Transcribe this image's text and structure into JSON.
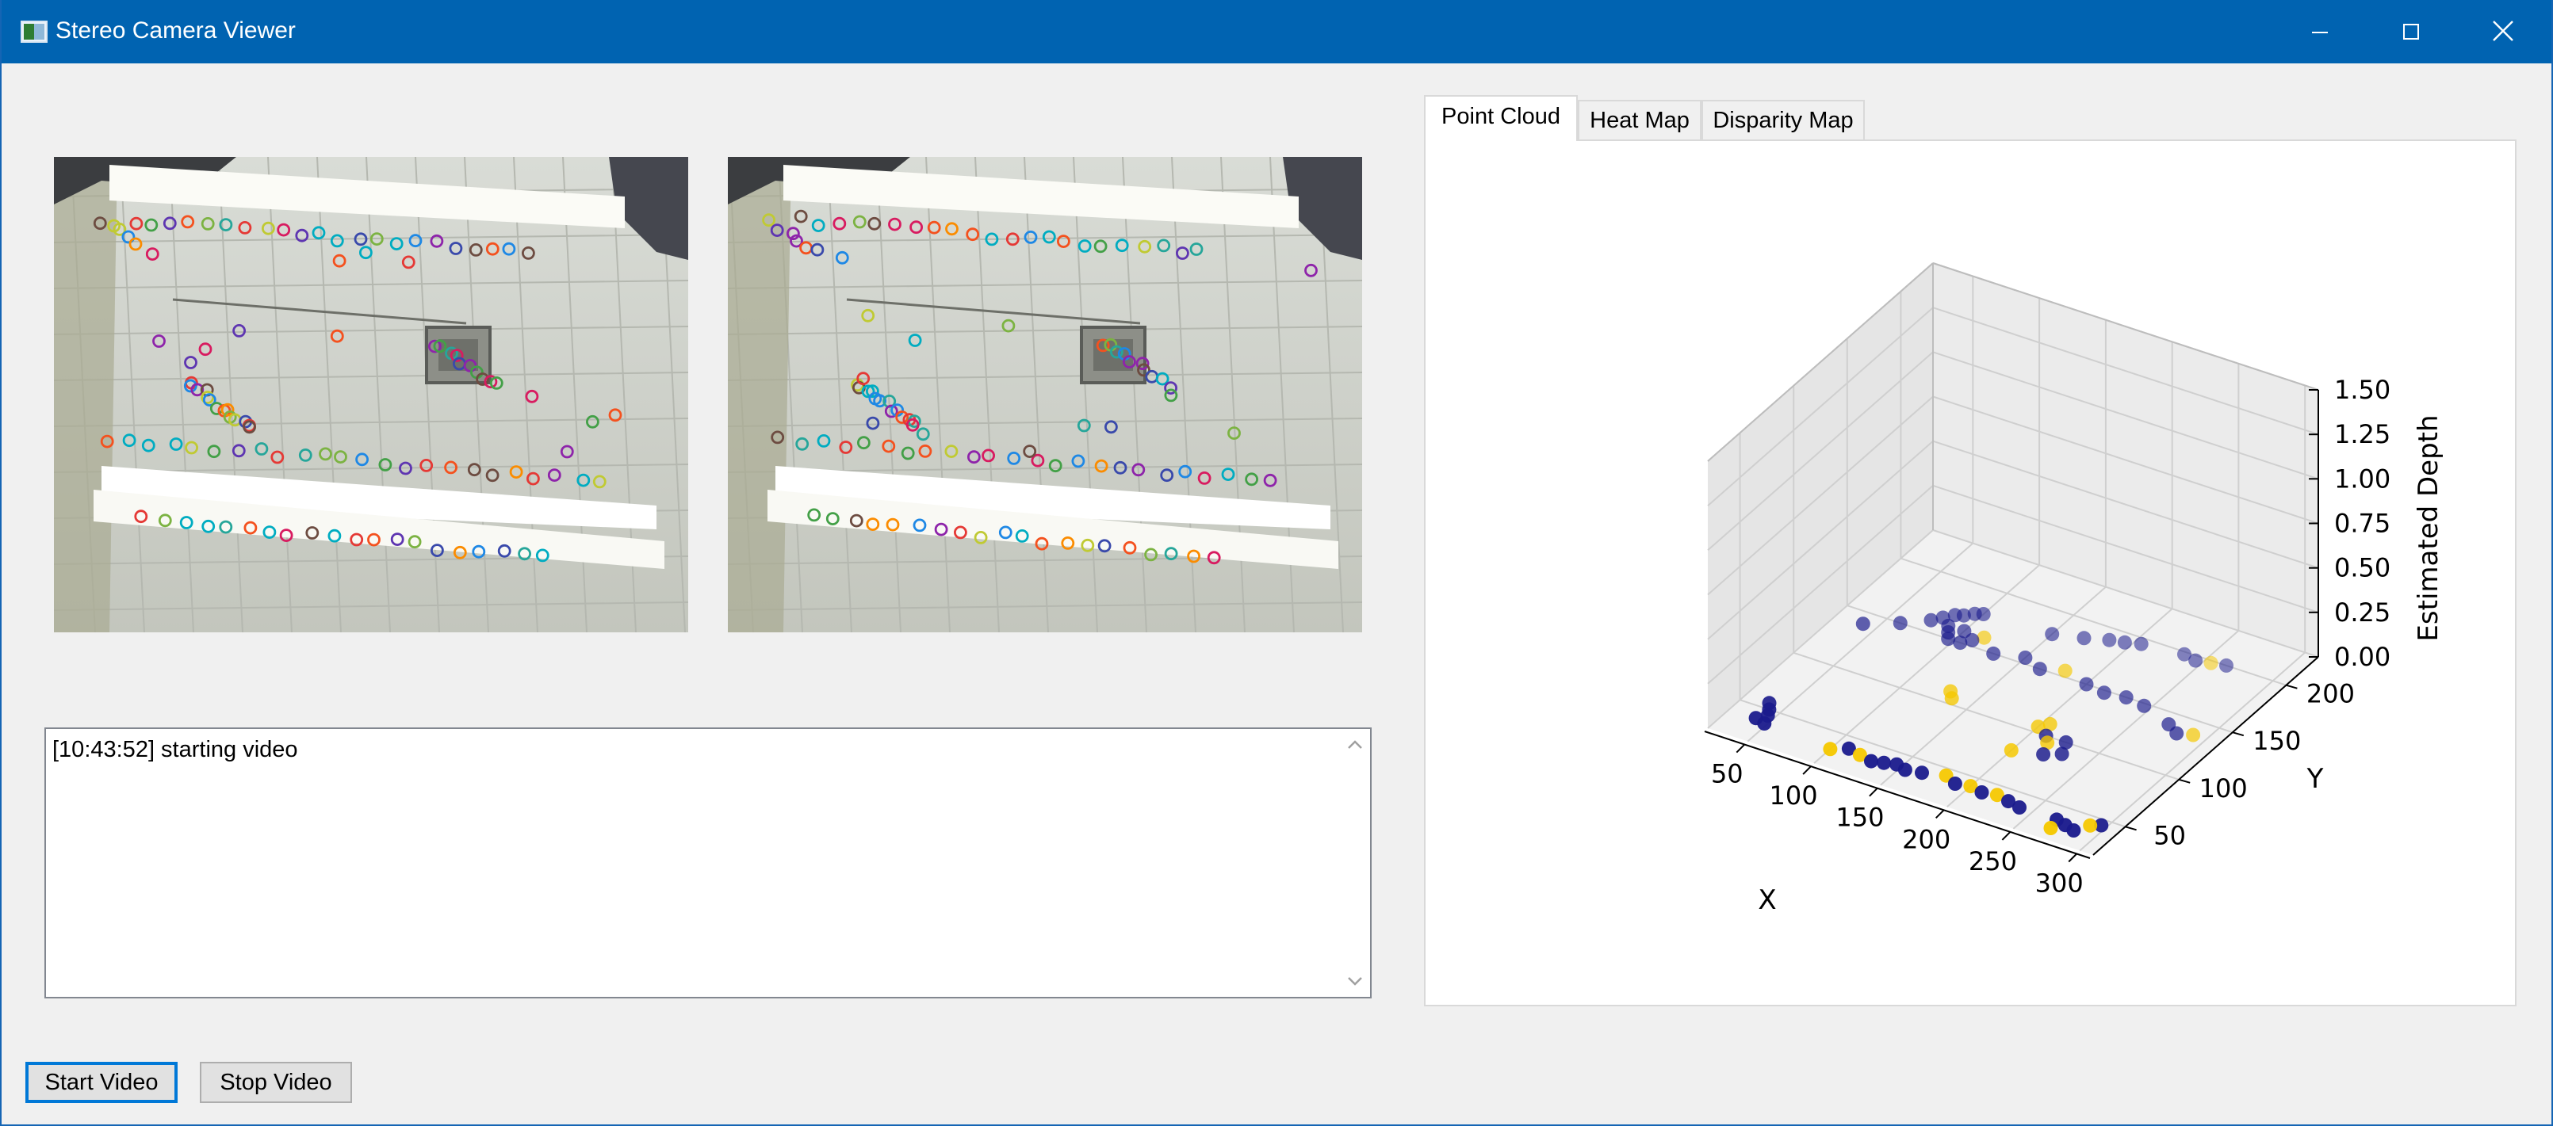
{
  "window": {
    "title": "Stereo Camera Viewer",
    "titlebar_color": "#0063b1",
    "controls": [
      "minimize-icon",
      "maximize-icon",
      "close-icon"
    ]
  },
  "cameras": {
    "left": {
      "content": "camera frame with feature keypoints"
    },
    "right": {
      "content": "camera frame with feature keypoints"
    }
  },
  "log": {
    "lines": [
      "[10:43:52] starting video"
    ]
  },
  "buttons": {
    "start": "Start Video",
    "stop": "Stop Video"
  },
  "tabs": [
    {
      "label": "Point Cloud",
      "selected": true
    },
    {
      "label": "Heat Map",
      "selected": false
    },
    {
      "label": "Disparity Map",
      "selected": false
    }
  ],
  "chart_data": {
    "type": "scatter",
    "projection": "3d",
    "title": "",
    "xlabel": "X",
    "ylabel": "Y",
    "zlabel": "Estimated Depth",
    "x_ticks": [
      "50",
      "100",
      "150",
      "200",
      "250",
      "300"
    ],
    "y_ticks": [
      "50",
      "100",
      "150",
      "200"
    ],
    "z_ticks": [
      "0.00",
      "0.25",
      "0.50",
      "0.75",
      "1.00",
      "1.25",
      "1.50"
    ],
    "xlim": [
      20,
      310
    ],
    "ylim": [
      20,
      230
    ],
    "zlim": [
      0,
      1.5
    ],
    "grid": true,
    "colors": {
      "low": "#1a1a8c",
      "high": "#f5c800"
    },
    "points": [
      {
        "x": 40,
        "y": 40,
        "z": 0.0,
        "c": "low"
      },
      {
        "x": 42,
        "y": 50,
        "z": 0.0,
        "c": "low"
      },
      {
        "x": 45,
        "y": 45,
        "z": 0.0,
        "c": "low"
      },
      {
        "x": 48,
        "y": 38,
        "z": 0.0,
        "c": "low"
      },
      {
        "x": 38,
        "y": 55,
        "z": 0.0,
        "c": "low"
      },
      {
        "x": 100,
        "y": 35,
        "z": 0.0,
        "c": "high"
      },
      {
        "x": 110,
        "y": 40,
        "z": 0.0,
        "c": "low"
      },
      {
        "x": 120,
        "y": 38,
        "z": 0.0,
        "c": "high"
      },
      {
        "x": 130,
        "y": 36,
        "z": 0.0,
        "c": "low"
      },
      {
        "x": 138,
        "y": 38,
        "z": 0.0,
        "c": "low"
      },
      {
        "x": 146,
        "y": 40,
        "z": 0.0,
        "c": "low"
      },
      {
        "x": 154,
        "y": 38,
        "z": 0.0,
        "c": "low"
      },
      {
        "x": 165,
        "y": 40,
        "z": 0.0,
        "c": "low"
      },
      {
        "x": 180,
        "y": 44,
        "z": 0.0,
        "c": "high"
      },
      {
        "x": 190,
        "y": 40,
        "z": 0.0,
        "c": "low"
      },
      {
        "x": 200,
        "y": 42,
        "z": 0.0,
        "c": "high"
      },
      {
        "x": 210,
        "y": 40,
        "z": 0.0,
        "c": "low"
      },
      {
        "x": 220,
        "y": 42,
        "z": 0.0,
        "c": "high"
      },
      {
        "x": 230,
        "y": 40,
        "z": 0.0,
        "c": "low"
      },
      {
        "x": 240,
        "y": 38,
        "z": 0.0,
        "c": "low"
      },
      {
        "x": 268,
        "y": 38,
        "z": 0.0,
        "c": "low"
      },
      {
        "x": 276,
        "y": 36,
        "z": 0.0,
        "c": "low"
      },
      {
        "x": 284,
        "y": 34,
        "z": 0.0,
        "c": "low"
      },
      {
        "x": 290,
        "y": 42,
        "z": 0.0,
        "c": "high"
      },
      {
        "x": 296,
        "y": 45,
        "z": 0.0,
        "c": "low"
      },
      {
        "x": 270,
        "y": 30,
        "z": 0.0,
        "c": "high"
      },
      {
        "x": 40,
        "y": 140,
        "z": 0.0,
        "c": "low"
      },
      {
        "x": 60,
        "y": 150,
        "z": 0.0,
        "c": "low"
      },
      {
        "x": 75,
        "y": 160,
        "z": 0.0,
        "c": "low"
      },
      {
        "x": 80,
        "y": 165,
        "z": 0.0,
        "c": "low"
      },
      {
        "x": 85,
        "y": 170,
        "z": 0.0,
        "c": "low"
      },
      {
        "x": 90,
        "y": 172,
        "z": 0.0,
        "c": "low"
      },
      {
        "x": 95,
        "y": 176,
        "z": 0.0,
        "c": "low"
      },
      {
        "x": 100,
        "y": 178,
        "z": 0.0,
        "c": "low"
      },
      {
        "x": 88,
        "y": 160,
        "z": 0.0,
        "c": "low"
      },
      {
        "x": 92,
        "y": 155,
        "z": 0.0,
        "c": "low"
      },
      {
        "x": 96,
        "y": 150,
        "z": 0.0,
        "c": "low"
      },
      {
        "x": 100,
        "y": 160,
        "z": 0.0,
        "c": "low"
      },
      {
        "x": 105,
        "y": 150,
        "z": 0.0,
        "c": "low"
      },
      {
        "x": 110,
        "y": 155,
        "z": 0.0,
        "c": "low"
      },
      {
        "x": 115,
        "y": 160,
        "z": 0.0,
        "c": "high"
      },
      {
        "x": 150,
        "y": 180,
        "z": 0.0,
        "c": "low"
      },
      {
        "x": 170,
        "y": 185,
        "z": 0.0,
        "c": "low"
      },
      {
        "x": 185,
        "y": 190,
        "z": 0.0,
        "c": "low"
      },
      {
        "x": 195,
        "y": 192,
        "z": 0.0,
        "c": "low"
      },
      {
        "x": 205,
        "y": 195,
        "z": 0.0,
        "c": "low"
      },
      {
        "x": 235,
        "y": 198,
        "z": 0.0,
        "c": "low"
      },
      {
        "x": 245,
        "y": 196,
        "z": 0.0,
        "c": "low"
      },
      {
        "x": 255,
        "y": 198,
        "z": 0.0,
        "c": "high"
      },
      {
        "x": 265,
        "y": 200,
        "z": 0.0,
        "c": "low"
      },
      {
        "x": 130,
        "y": 150,
        "z": 0.0,
        "c": "low"
      },
      {
        "x": 150,
        "y": 155,
        "z": 0.0,
        "c": "low"
      },
      {
        "x": 165,
        "y": 150,
        "z": 0.0,
        "c": "low"
      },
      {
        "x": 180,
        "y": 155,
        "z": 0.0,
        "c": "high"
      },
      {
        "x": 200,
        "y": 150,
        "z": 0.0,
        "c": "low"
      },
      {
        "x": 215,
        "y": 148,
        "z": 0.0,
        "c": "low"
      },
      {
        "x": 230,
        "y": 150,
        "z": 0.0,
        "c": "low"
      },
      {
        "x": 245,
        "y": 148,
        "z": 0.0,
        "c": "low"
      },
      {
        "x": 270,
        "y": 140,
        "z": 0.0,
        "c": "low"
      },
      {
        "x": 280,
        "y": 135,
        "z": 0.0,
        "c": "low"
      },
      {
        "x": 290,
        "y": 138,
        "z": 0.0,
        "c": "high"
      },
      {
        "x": 130,
        "y": 110,
        "z": 0.0,
        "c": "high"
      },
      {
        "x": 135,
        "y": 105,
        "z": 0.0,
        "c": "high"
      },
      {
        "x": 200,
        "y": 105,
        "z": 0.0,
        "c": "high"
      },
      {
        "x": 205,
        "y": 110,
        "z": 0.0,
        "c": "high"
      },
      {
        "x": 210,
        "y": 100,
        "z": 0.0,
        "c": "low"
      },
      {
        "x": 215,
        "y": 95,
        "z": 0.0,
        "c": "high"
      },
      {
        "x": 225,
        "y": 100,
        "z": 0.0,
        "c": "low"
      },
      {
        "x": 220,
        "y": 85,
        "z": 0.0,
        "c": "low"
      },
      {
        "x": 200,
        "y": 80,
        "z": 0.0,
        "c": "high"
      },
      {
        "x": 230,
        "y": 90,
        "z": 0.0,
        "c": "low"
      }
    ]
  }
}
